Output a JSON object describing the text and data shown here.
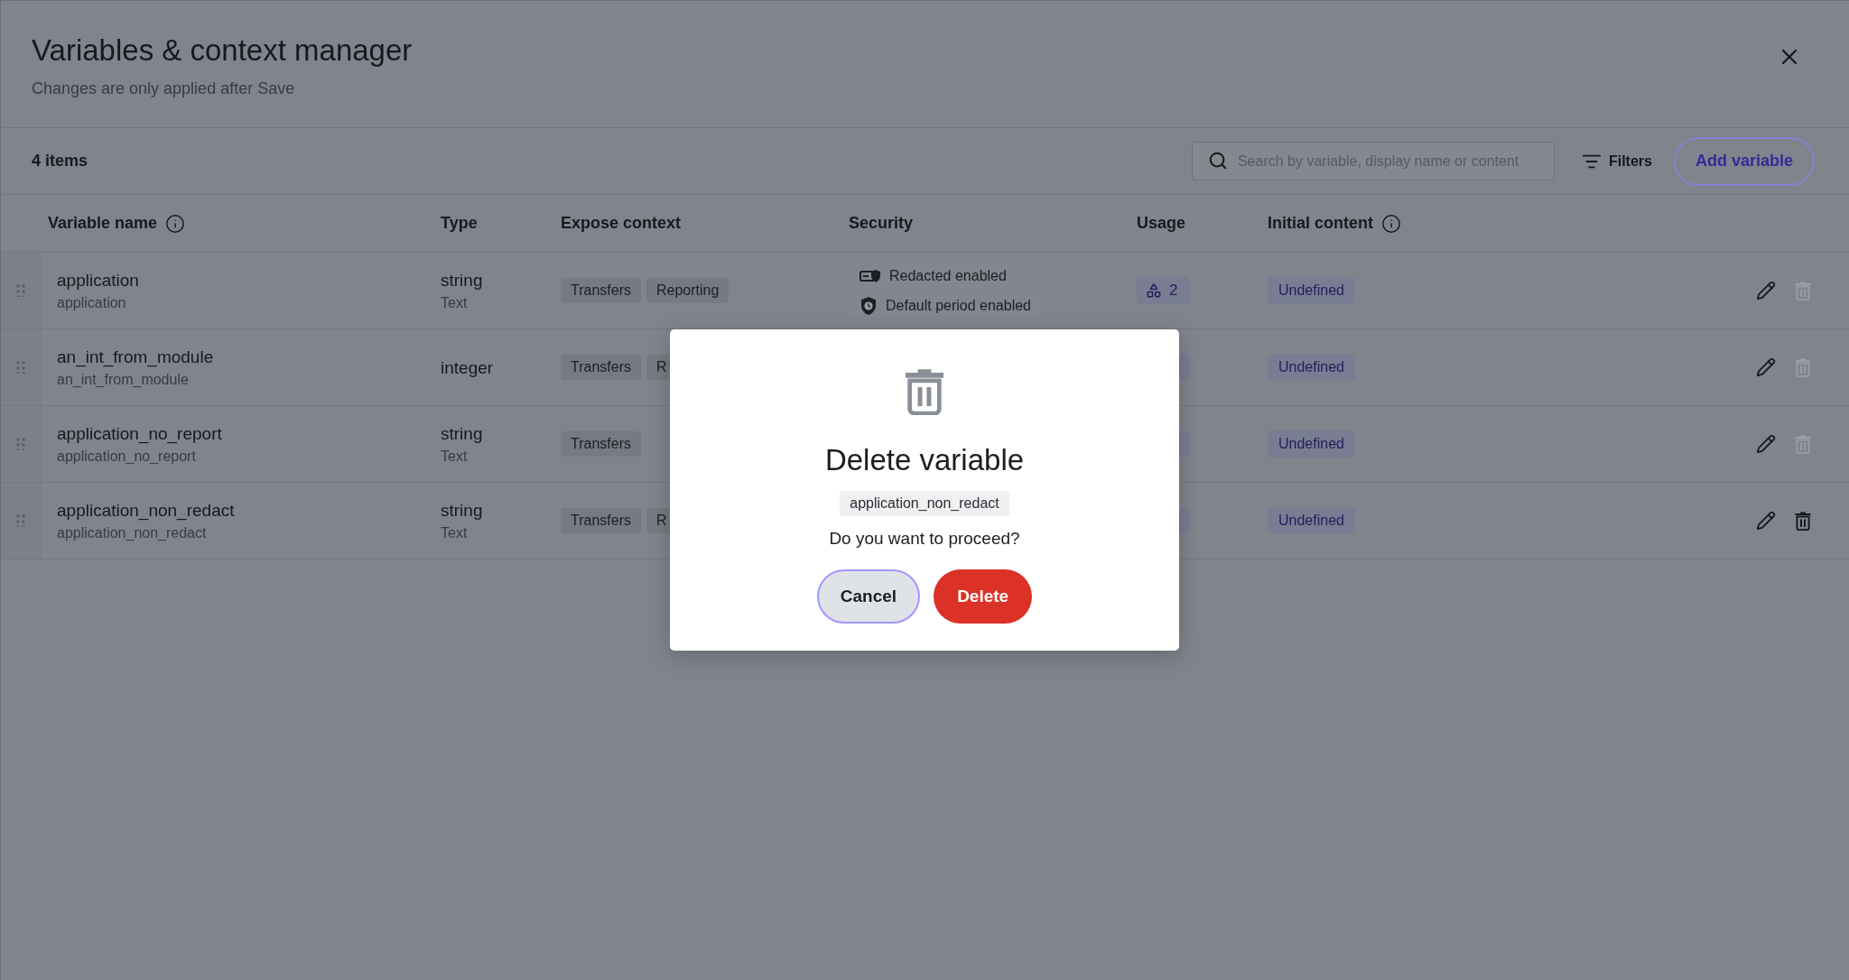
{
  "window": {
    "title": "Variables & context manager",
    "subtitle": "Changes are only applied after Save"
  },
  "toolbar": {
    "count": "4 items",
    "search": {
      "placeholder": "Search by variable, display name or content"
    },
    "filters": "Filters",
    "add_button": "Add variable"
  },
  "table": {
    "columns": [
      {
        "label": "Variable name",
        "info": true
      },
      {
        "label": "Type",
        "info": false
      },
      {
        "label": "Expose context",
        "info": false
      },
      {
        "label": "Security",
        "info": false
      },
      {
        "label": "Usage",
        "info": false
      },
      {
        "label": "Initial content",
        "info": true
      }
    ],
    "rows": [
      {
        "name": "application",
        "display_name": "application",
        "type": "string",
        "type_label": "Text",
        "contexts": [
          "Transfers",
          "Reporting"
        ],
        "security": [
          {
            "kind": "redacted",
            "label": "Redacted enabled"
          },
          {
            "kind": "period",
            "label": "Default period enabled"
          }
        ],
        "usage_chip": true,
        "usage_count": "2",
        "initial_content": "Undefined",
        "delete_active": false
      },
      {
        "name": "an_int_from_module",
        "display_name": "an_int_from_module",
        "type": "integer",
        "contexts": [
          "Transfers",
          "R"
        ],
        "usage_chip": true,
        "initial_content": "Undefined",
        "delete_active": false
      },
      {
        "name": "application_no_report",
        "display_name": "application_no_report",
        "type": "string",
        "type_label": "Text",
        "contexts": [
          "Transfers"
        ],
        "usage_chip": true,
        "initial_content": "Undefined",
        "delete_active": false
      },
      {
        "name": "application_non_redact",
        "display_name": "application_non_redact",
        "type": "string",
        "type_label": "Text",
        "contexts": [
          "Transfers",
          "R"
        ],
        "usage_chip": true,
        "initial_content": "Undefined",
        "delete_active": true
      }
    ]
  },
  "dialog": {
    "title": "Delete variable",
    "variable": "application_non_redact",
    "question": "Do you want to proceed?",
    "buttons": [
      {
        "label": "Cancel",
        "kind": "secondary",
        "focused": true
      },
      {
        "label": "Delete",
        "kind": "danger",
        "focused": false
      }
    ]
  }
}
